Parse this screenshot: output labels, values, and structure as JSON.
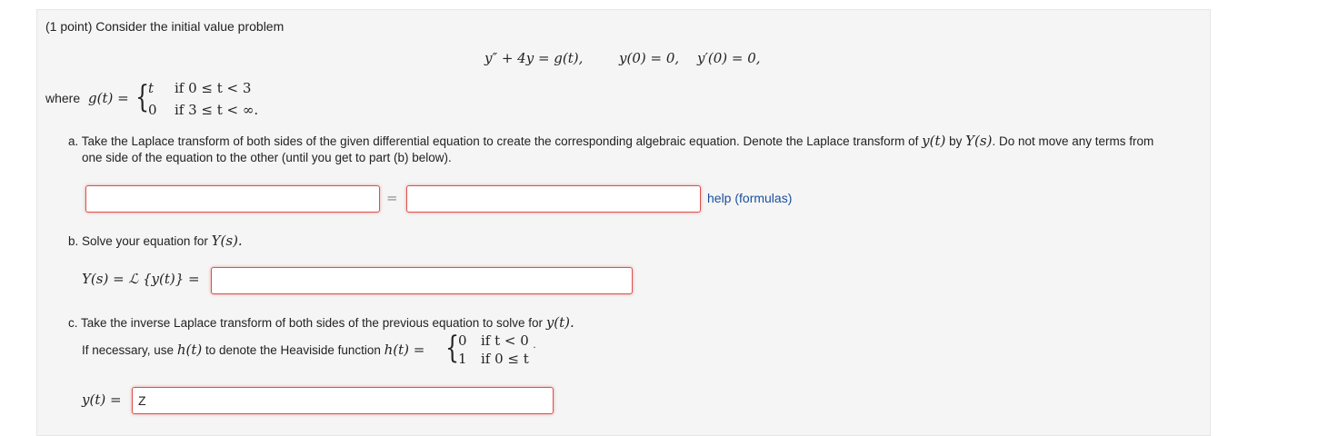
{
  "problem": {
    "intro": "(1 point) Consider the initial value problem",
    "ode": "y″ + 4y = g(t),",
    "ic1": "y(0) = 0,",
    "ic2": "y′(0) = 0,",
    "where_label": "where",
    "g_lhs": "g(t) =",
    "g_cases": [
      {
        "value": "t",
        "condition": "if 0 ≤ t < 3"
      },
      {
        "value": "0",
        "condition": "if 3 ≤ t < ∞."
      }
    ]
  },
  "part_a": {
    "text_line1_before": "a. Take the Laplace transform of both sides of the given differential equation to create the corresponding algebraic equation. Denote the Laplace transform of",
    "y_t": "y(t)",
    "by": "by",
    "Y_s": "Y(s)",
    "text_line1_after": ". Do not move any terms from",
    "text_line2": "one side of the equation to the other (until you get to part (b) below).",
    "equals": "=",
    "left_value": "",
    "right_value": "",
    "help_link": "help (formulas)"
  },
  "part_b": {
    "text": "b. Solve your equation for",
    "Y_s": "Y(s).",
    "lhs": "Y(s) = ℒ {y(t)} =",
    "answer_value": ""
  },
  "part_c": {
    "text": "c. Take the inverse Laplace transform of both sides of the previous equation to solve for",
    "y_t": "y(t).",
    "heaviside_text": "If necessary, use",
    "h_t": "h(t)",
    "heaviside_text2": "to denote the Heaviside function",
    "h_lhs": "h(t) =",
    "h_cases": [
      {
        "value": "0",
        "condition": "if t < 0"
      },
      {
        "value": "1",
        "condition": "if 0 ≤ t"
      }
    ],
    "dot": "˙",
    "lhs": "y(t) =",
    "answer_value": "Z"
  }
}
